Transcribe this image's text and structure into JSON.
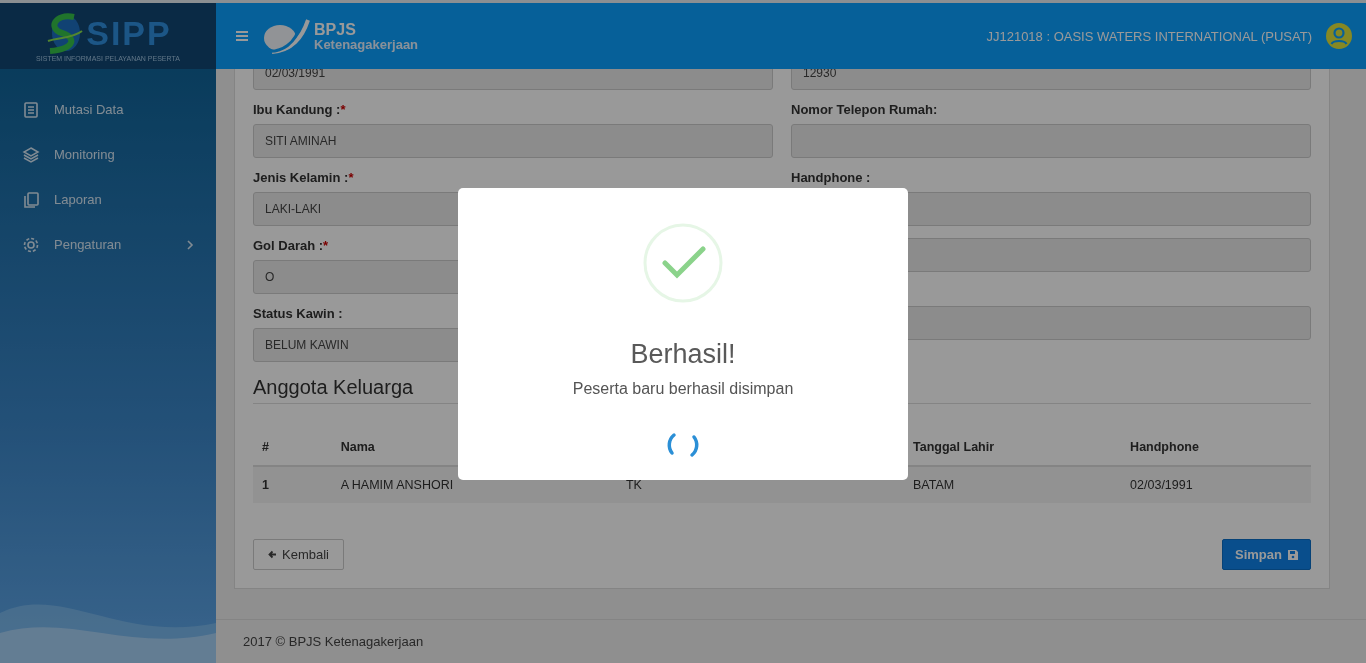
{
  "sidebar": {
    "brand": {
      "title": "SIPP",
      "subtitle": "SISTEM INFORMASI PELAYANAN PESERTA"
    },
    "items": [
      {
        "label": "Mutasi Data",
        "submenu": false
      },
      {
        "label": "Monitoring",
        "submenu": false
      },
      {
        "label": "Laporan",
        "submenu": false
      },
      {
        "label": "Pengaturan",
        "submenu": true
      }
    ]
  },
  "header": {
    "org_logo": {
      "title": "BPJS",
      "subtitle": "Ketenagakerjaan"
    },
    "user": "JJ121018 : OASIS WATERS INTERNATIONAL (PUSAT)"
  },
  "form": {
    "rows": [
      {
        "left": {
          "value": "02/03/1991",
          "disabled": true
        },
        "right": {
          "value": "12930",
          "disabled": true
        }
      },
      {
        "left": {
          "label": "Ibu Kandung :",
          "required_mark": "*",
          "value": "SITI AMINAH",
          "disabled": true
        },
        "right": {
          "label": "Nomor Telepon Rumah:",
          "disabled": true
        }
      },
      {
        "left": {
          "label": "Jenis Kelamin :",
          "required_mark": "*",
          "value": "LAKI-LAKI",
          "disabled": true
        },
        "right": {
          "label": "Handphone :",
          "disabled": true
        }
      },
      {
        "left": {
          "label": "Gol Darah :",
          "required_mark": "*",
          "value": "O",
          "disabled": true
        },
        "right": {
          "disabled": true
        }
      },
      {
        "left": {
          "label": "Status Kawin :",
          "value": "BELUM KAWIN",
          "disabled": true
        },
        "right": {
          "disabled": true
        }
      }
    ]
  },
  "family": {
    "title": "Anggota Keluarga",
    "columns": [
      {
        "label": "#"
      },
      {
        "label": "Nama"
      },
      null,
      {
        "label": "Tanggal Lahir"
      },
      {
        "label": "Handphone"
      }
    ],
    "rows": [
      [
        "1",
        "A HAMIM ANSHORI",
        "TK",
        "BATAM",
        "02/03/1991"
      ]
    ]
  },
  "buttons": {
    "back": "Kembali",
    "save": "Simpan"
  },
  "footer": "2017 © BPJS Ketenagakerjaan",
  "dialog": {
    "title": "Berhasil!",
    "message": "Peserta baru berhasil disimpan",
    "loading": true
  }
}
